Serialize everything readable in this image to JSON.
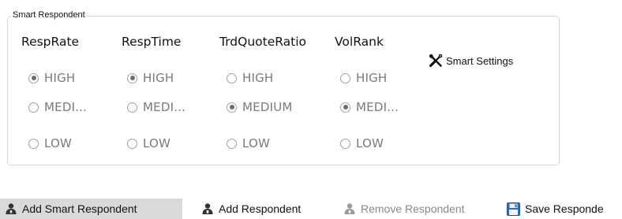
{
  "group": {
    "title": "Smart Respondent"
  },
  "columns": [
    {
      "header": "RespRate",
      "options": [
        {
          "label": "HIGH",
          "checked": true
        },
        {
          "label": "MEDI...",
          "checked": false
        },
        {
          "label": "LOW",
          "checked": false
        }
      ]
    },
    {
      "header": "RespTime",
      "options": [
        {
          "label": "HIGH",
          "checked": true
        },
        {
          "label": "MEDI...",
          "checked": false
        },
        {
          "label": "LOW",
          "checked": false
        }
      ]
    },
    {
      "header": "TrdQuoteRatio",
      "options": [
        {
          "label": "HIGH",
          "checked": false
        },
        {
          "label": "MEDIUM",
          "checked": true
        },
        {
          "label": "LOW",
          "checked": false
        }
      ]
    },
    {
      "header": "VolRank",
      "options": [
        {
          "label": "HIGH",
          "checked": false
        },
        {
          "label": "MEDI...",
          "checked": true
        },
        {
          "label": "LOW",
          "checked": false
        }
      ]
    }
  ],
  "smart_settings": {
    "label": "Smart Settings",
    "icon": "wrench-screwdriver-icon"
  },
  "toolbar": {
    "add_smart_respondent": "Add Smart Respondent",
    "add_respondent": "Add Respondent",
    "remove_respondent": "Remove Respondent",
    "save_respondent": "Save Responde",
    "active_color": "#d9d9d9",
    "disabled_color": "#8a8a8a"
  }
}
